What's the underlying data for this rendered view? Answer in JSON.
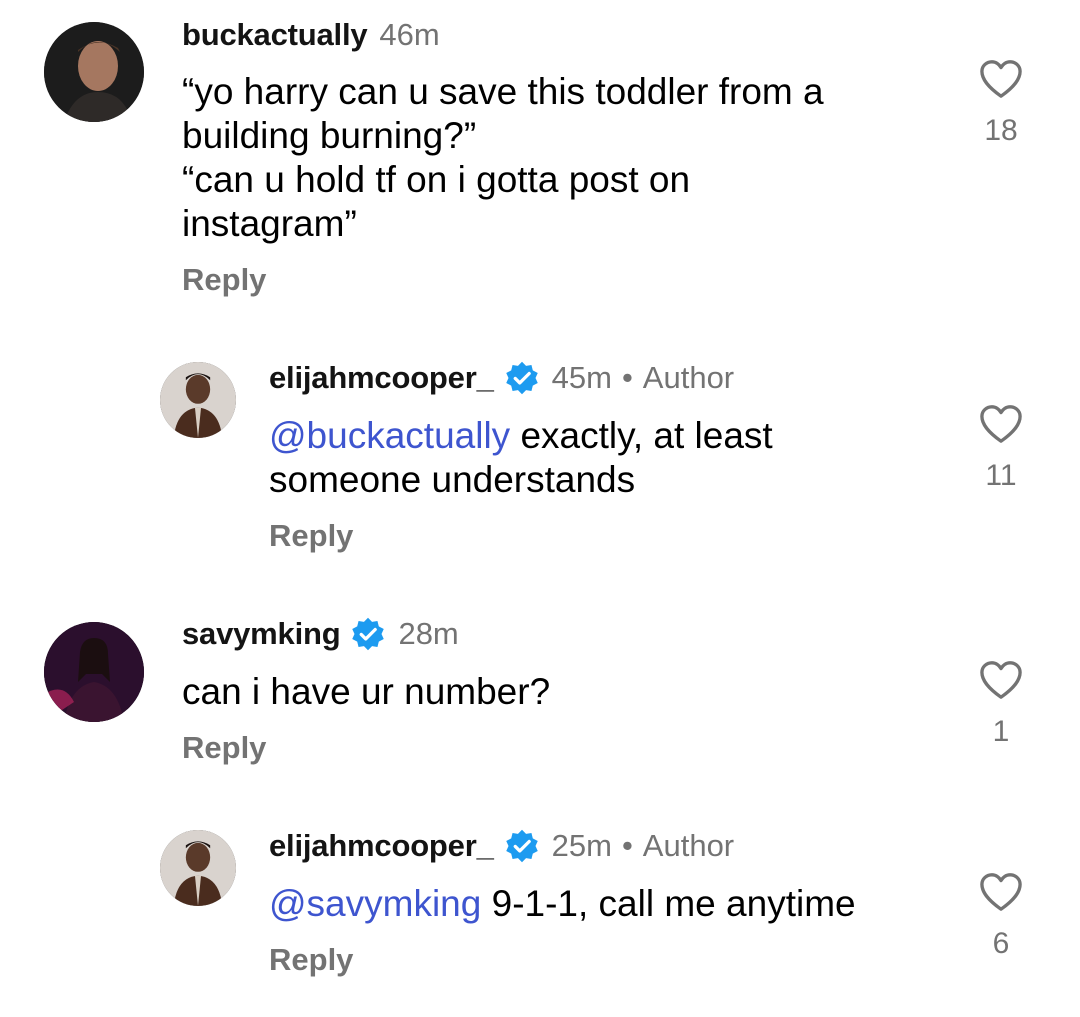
{
  "comments": [
    {
      "username": "buckactually",
      "time": "46m",
      "verified": false,
      "lines": [
        "“yo harry can u save this toddler from a",
        "building burning?”",
        "“can u hold tf on i gotta post on",
        "instagram”"
      ],
      "reply": "Reply",
      "likes": "18"
    },
    {
      "username": "elijahmcooper_",
      "time": "45m",
      "verified": true,
      "dot": "•",
      "author": "Author",
      "mention": "@buckactually",
      "mention_icon": "threads-icon",
      "line1_rest": " exactly, at least",
      "line2": "someone understands",
      "reply": "Reply",
      "likes": "11"
    },
    {
      "username": "savymking",
      "time": "28m",
      "verified": true,
      "lines": [
        "can i have ur number?"
      ],
      "reply": "Reply",
      "likes": "1"
    },
    {
      "username": "elijahmcooper_",
      "time": "25m",
      "verified": true,
      "dot": "•",
      "author": "Author",
      "mention": "@savymking",
      "mention_icon": "threads-icon",
      "line1_rest": " 9-1-1, call me anytime",
      "reply": "Reply",
      "likes": "6"
    }
  ],
  "colors": {
    "secondary_text": "#737373",
    "mention": "#3e55cf",
    "verified_badge": "#1d9bf0"
  }
}
